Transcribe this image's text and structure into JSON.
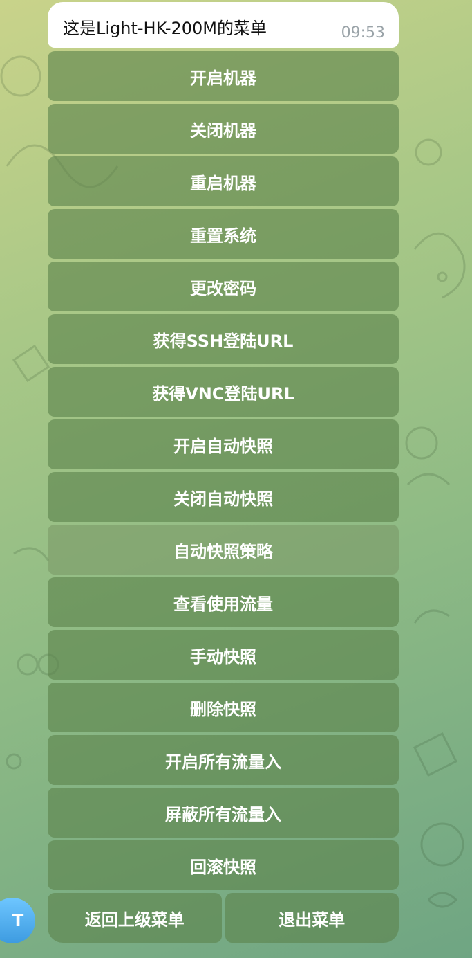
{
  "message": {
    "text": "这是Light-HK-200M的菜单",
    "time": "09:53"
  },
  "keyboard": {
    "buttons": [
      "开启机器",
      "关闭机器",
      "重启机器",
      "重置系统",
      "更改密码",
      "获得SSH登陆URL",
      "获得VNC登陆URL",
      "开启自动快照",
      "关闭自动快照",
      "自动快照策略",
      "查看使用流量",
      "手动快照",
      "删除快照",
      "开启所有流量入",
      "屏蔽所有流量入",
      "回滚快照"
    ],
    "bottom_left": "返回上级菜单",
    "bottom_right": "退出菜单"
  },
  "avatar": {
    "initial": "T"
  },
  "colors": {
    "button_bg": "#5c824c",
    "avatar_top": "#6ec6ff",
    "avatar_bottom": "#3d9be0"
  }
}
